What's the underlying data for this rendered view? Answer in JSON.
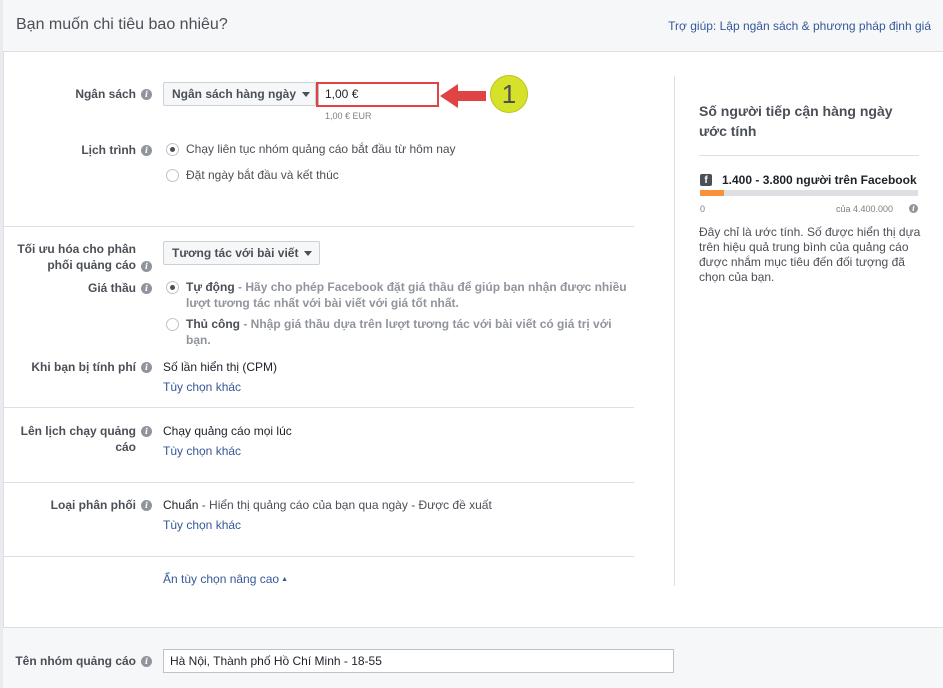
{
  "header": {
    "title": "Bạn muốn chi tiêu bao nhiêu?",
    "help_link": "Trợ giúp: Lập ngân sách & phương pháp định giá"
  },
  "budget": {
    "label": "Ngân sách",
    "type_selected": "Ngân sách hàng ngày",
    "amount_value": "1,00 €",
    "amount_caption": "1,00 € EUR",
    "callout_number": "1"
  },
  "schedule": {
    "label": "Lịch trình",
    "options": [
      {
        "label": "Chạy liên tục nhóm quảng cáo bắt đầu từ hôm nay",
        "selected": true
      },
      {
        "label": "Đặt ngày bắt đầu và kết thúc",
        "selected": false
      }
    ]
  },
  "optimization": {
    "label_line1": "Tối ưu hóa cho phân",
    "label_line2": "phối quảng cáo",
    "selected": "Tương tác với bài viết"
  },
  "bid": {
    "label": "Giá thầu",
    "auto_title": "Tự động",
    "auto_desc_line1": " - Hãy cho phép Facebook đặt giá thầu để giúp bạn nhận được nhiều",
    "auto_desc_line2": "lượt tương tác nhất với bài viết với giá tốt nhất.",
    "manual_title": "Thủ công",
    "manual_desc": " - Nhập giá thầu dựa trên lượt tương tác với bài viết có giá trị với bạn."
  },
  "charged": {
    "label": "Khi bạn bị tính phí",
    "value": "Số lần hiển thị (CPM)",
    "more_link": "Tùy chọn khác"
  },
  "ad_scheduling": {
    "label_line1": "Lên lịch chạy quảng",
    "label_line2": "cáo",
    "value": "Chạy quảng cáo mọi lúc",
    "more_link": "Tùy chọn khác"
  },
  "delivery_type": {
    "label": "Loại phân phối",
    "value_bold": "Chuẩn",
    "value_rest": " - Hiển thị quảng cáo của bạn qua ngày - Được đề xuất",
    "more_link": "Tùy chọn khác"
  },
  "advanced_toggle": "Ẩn tùy chọn nâng cao",
  "estimate": {
    "title": "Số người tiếp cận hàng ngày ước tính",
    "range": "1.400 - 3.800 người trên Facebook",
    "bar_fraction": 0.11,
    "min_label": "0",
    "max_label": "của 4.400.000",
    "note": "Đây chỉ là ước tính. Số được hiển thị dựa trên hiệu quả trung bình của quảng cáo được nhắm mục tiêu đến đối tượng đã chọn của bạn.",
    "accent_color": "#f7923a"
  },
  "adset_name": {
    "label": "Tên nhóm quảng cáo",
    "value": "Hà Nội, Thành phố Hồ Chí Minh - 18-55"
  },
  "icons": {
    "info": "info-icon",
    "dropdown": "chevron-down-icon",
    "facebook": "facebook-icon",
    "arrow": "red-arrow-icon"
  }
}
